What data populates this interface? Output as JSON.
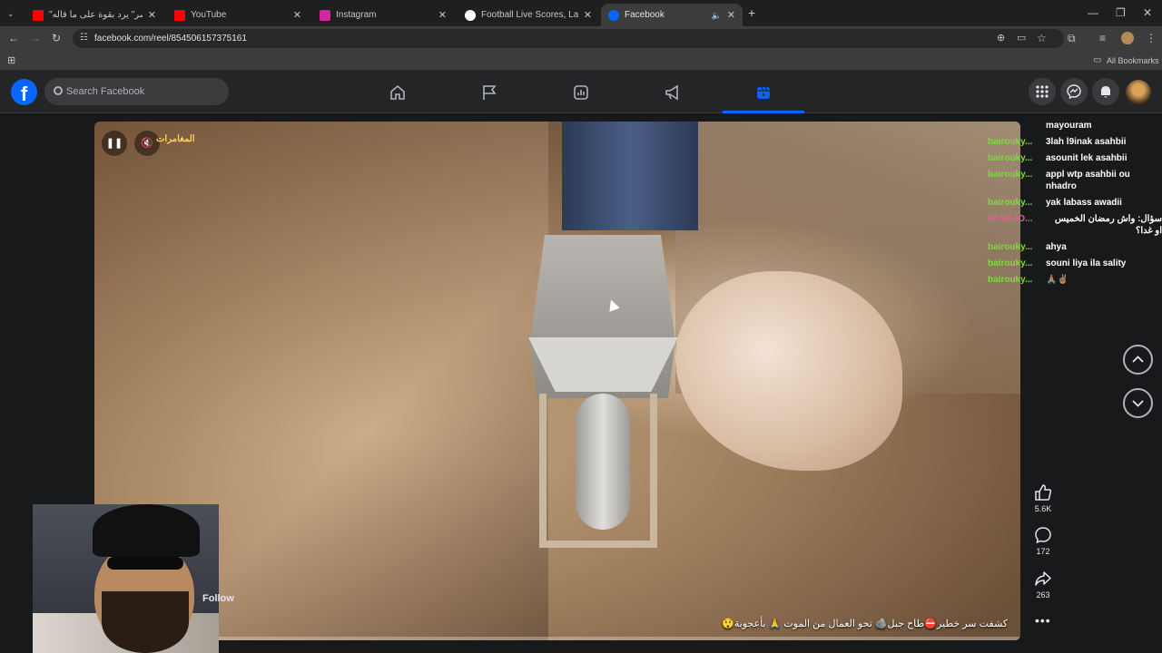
{
  "browser": {
    "tabs": [
      {
        "title": "\"القيصر\" يرد بقوة على ما قاله wa",
        "favicon_color": "#ff0000",
        "active": false
      },
      {
        "title": "YouTube",
        "favicon_color": "#ff0000",
        "active": false
      },
      {
        "title": "Instagram",
        "favicon_color": "#d6249f",
        "active": false
      },
      {
        "title": "Football Live Scores, Latest Foo",
        "favicon_color": "#ffffff",
        "active": false
      },
      {
        "title": "Facebook",
        "favicon_color": "#0866ff",
        "active": true
      }
    ],
    "url": "facebook.com/reel/854506157375161",
    "bookmarks_label": "All Bookmarks"
  },
  "facebook": {
    "logo": "f",
    "search_placeholder": "Search Facebook",
    "nav": [
      "home-icon",
      "flag-icon",
      "marketplace-icon",
      "megaphone-icon",
      "reels-icon"
    ],
    "active_nav": "reels-icon"
  },
  "reel": {
    "channel_label": "المغامرات",
    "caption": "كشفت سر خطير⛔طاح جبل🪨 تحو العمال من الموت 🙏 بأعجوبة😲",
    "progress": 0.04,
    "follow_label": "Follow",
    "likes": "5.6K",
    "comments": "172",
    "shares": "263"
  },
  "chat": [
    {
      "user": "",
      "text": "mayouram"
    },
    {
      "user": "bairouky...",
      "text": "3lah l9inak asahbii"
    },
    {
      "user": "bairouky...",
      "text": "asounit lek asahbii"
    },
    {
      "user": "bairouky...",
      "text": "appl wtp asahbii ou nhadro"
    },
    {
      "user": "bairouky...",
      "text": "yak labass awadii"
    },
    {
      "user": "ELMAJD...",
      "text": "سؤال: واش رمضان الخميس او غدا؟",
      "rtl": true,
      "pink": true
    },
    {
      "user": "bairouky...",
      "text": "ahya"
    },
    {
      "user": "bairouky...",
      "text": "souni liya ila sality"
    },
    {
      "user": "bairouky...",
      "text": "🙏🏽✌🏽"
    }
  ]
}
